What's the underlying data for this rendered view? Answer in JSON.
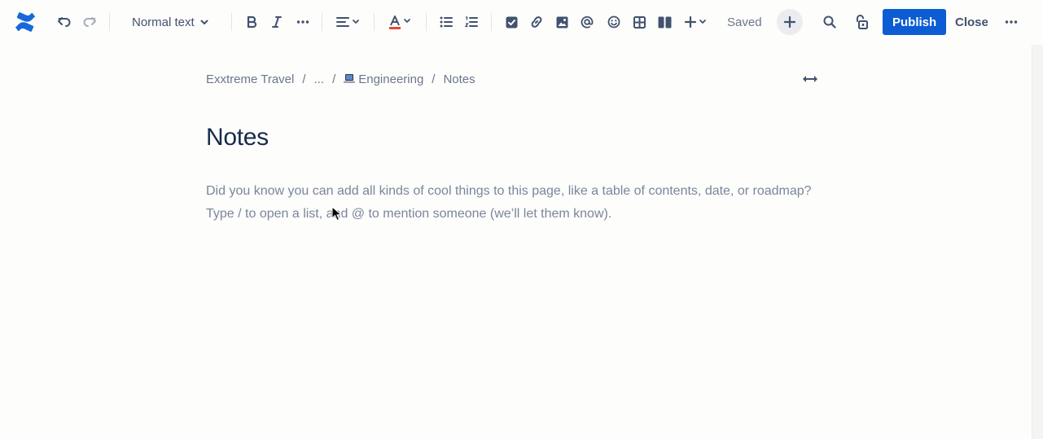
{
  "toolbar": {
    "text_style": "Normal text",
    "saved_label": "Saved",
    "publish_label": "Publish",
    "close_label": "Close"
  },
  "breadcrumb": {
    "items": [
      "Exxtreme Travel",
      "...",
      "Engineering",
      "Notes"
    ]
  },
  "page": {
    "title": "Notes",
    "placeholder_line1": "Did you know you can add all kinds of cool things to this page, like a table of contents, date, or roadmap?",
    "placeholder_line2": "Type / to open a list, and @ to mention someone (we’ll let them know)."
  },
  "colors": {
    "brand": "#1868db",
    "publish_bg": "#0c5cd3",
    "text_primary": "#172b4d",
    "text_subtle": "#6b778c"
  },
  "icons": [
    "confluence-logo-icon",
    "undo-icon",
    "redo-icon",
    "chevron-down-icon",
    "bold-icon",
    "italic-icon",
    "more-formatting-icon",
    "align-icon",
    "text-color-icon",
    "bullet-list-icon",
    "numbered-list-icon",
    "task-checkbox-icon",
    "link-icon",
    "image-icon",
    "mention-icon",
    "emoji-icon",
    "table-icon",
    "layouts-icon",
    "insert-plus-icon",
    "search-icon",
    "unlock-icon",
    "more-icon",
    "expand-width-icon",
    "laptop-emoji-icon"
  ]
}
